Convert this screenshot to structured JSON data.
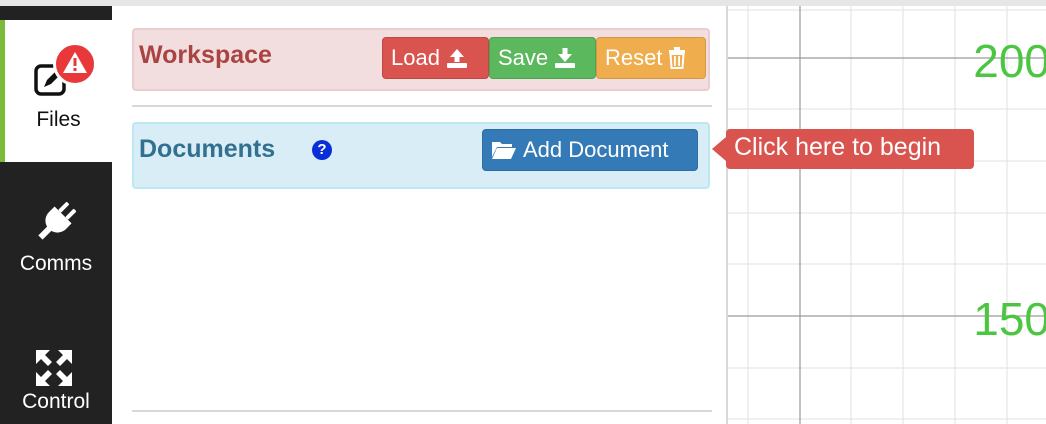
{
  "nav": {
    "tabs": [
      {
        "label": "Files",
        "icon": "files-icon",
        "active": true
      },
      {
        "label": "Comms",
        "icon": "plug-icon"
      },
      {
        "label": "Control",
        "icon": "arrows-expand-icon"
      }
    ],
    "alert_badge": "!"
  },
  "workspace": {
    "title": "Workspace",
    "buttons": {
      "load": "Load",
      "save": "Save",
      "reset": "Reset"
    }
  },
  "documents": {
    "title": "Documents",
    "help_icon": "?",
    "add_button": "Add Document"
  },
  "tooltip": "Click here to begin",
  "grid": {
    "labels": [
      "200",
      "150"
    ]
  },
  "colors": {
    "nav_bg": "#222222",
    "active_tab_accent": "#7cba3b",
    "danger": "#d9534f",
    "success": "#5cb85c",
    "warning": "#f0ad4e",
    "primary": "#337ab7",
    "grid_label": "#4cc640"
  }
}
